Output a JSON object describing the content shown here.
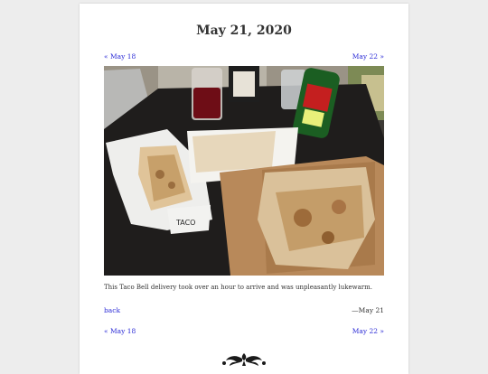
{
  "post": {
    "title": "May 21, 2020",
    "caption": "This Taco Bell delivery took over an hour to arrive and was unpleasantly lukewarm.",
    "date_stamp": "—May 21"
  },
  "nav": {
    "prev_label": "« May 18",
    "next_label": "May 22 »",
    "back_label": "back"
  },
  "photo": {
    "icon": "taco-bell-meal-photo"
  },
  "ornament": {
    "icon": "fleuron-ornament-icon"
  }
}
